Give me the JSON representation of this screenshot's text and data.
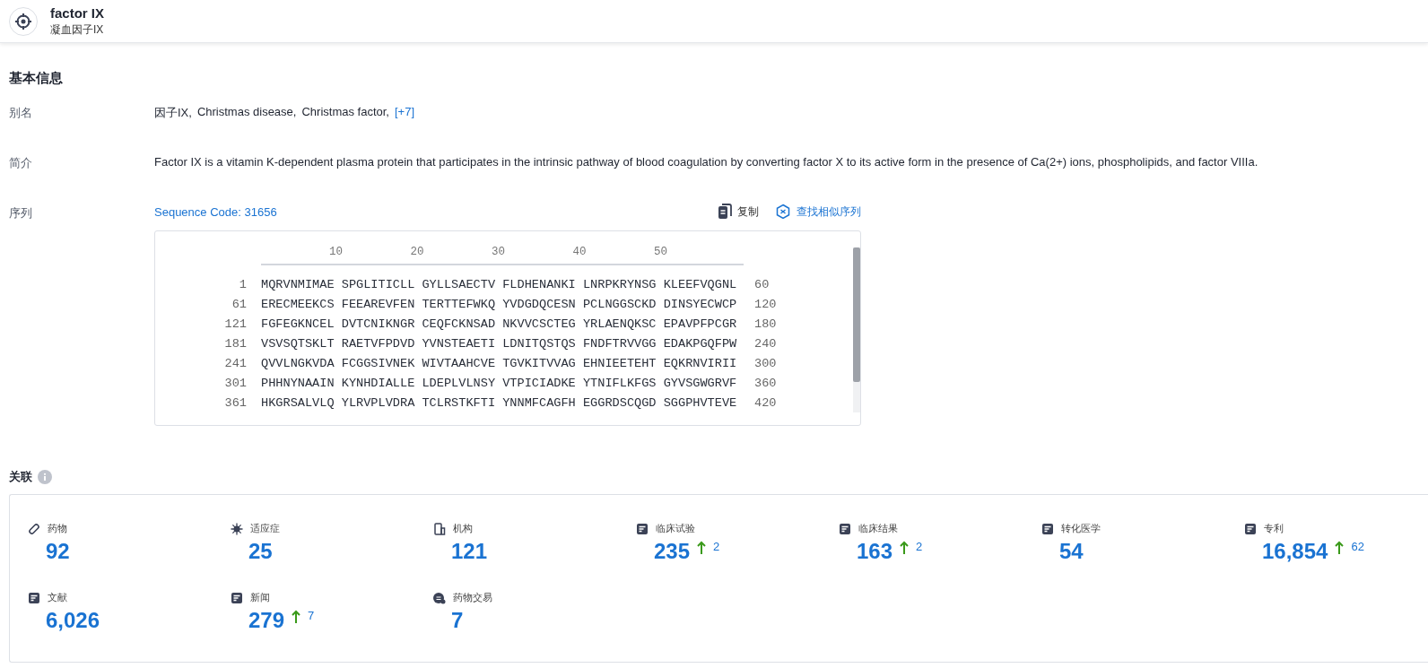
{
  "header": {
    "title": "factor IX",
    "subtitle": "凝血因子IX"
  },
  "basic_info": {
    "title": "基本信息",
    "aliases": {
      "label": "别名",
      "items": [
        "因子IX,",
        "Christmas disease,",
        "Christmas factor,"
      ],
      "more": "[+7]"
    },
    "summary": {
      "label": "简介",
      "text": "Factor IX is a vitamin K-dependent plasma protein that participates in the intrinsic pathway of blood coagulation by converting factor X to its active form in the presence of Ca(2+) ions, phospholipids, and factor VIIIa."
    },
    "sequence": {
      "label": "序列",
      "code": "Sequence Code: 31656",
      "copy": "复制",
      "find_similar": "查找相似序列",
      "ruler": [
        "10",
        "20",
        "30",
        "40",
        "50"
      ],
      "rows": [
        {
          "start": "1",
          "residues": "MQRVNMIMAE SPGLITICLL GYLLSAECTV FLDHENANKI LNRPKRYNSG KLEEFVQGNL",
          "end": "60"
        },
        {
          "start": "61",
          "residues": "ERECMEEKCS FEEAREVFEN TERTTEFWKQ YVDGDQCESN PCLNGGSCKD DINSYECWCP",
          "end": "120"
        },
        {
          "start": "121",
          "residues": "FGFEGKNCEL DVTCNIKNGR CEQFCKNSAD NKVVCSCTEG YRLAENQKSC EPAVPFPCGR",
          "end": "180"
        },
        {
          "start": "181",
          "residues": "VSVSQTSKLT RAETVFPDVD YVNSTEAETI LDNITQSTQS FNDFTRVVGG EDAKPGQFPW",
          "end": "240"
        },
        {
          "start": "241",
          "residues": "QVVLNGKVDA FCGGSIVNEK WIVTAAHCVE TGVKITVVAG EHNIEETEHT EQKRNVIRII",
          "end": "300"
        },
        {
          "start": "301",
          "residues": "PHHNYNAAIN KYNHDIALLE LDEPLVLNSY VTPICIADKE YTNIFLKFGS GYVSGWGRVF",
          "end": "360"
        },
        {
          "start": "361",
          "residues": "HKGRSALVLQ YLRVPLVDRA TCLRSTKFTI YNNMFCAGFH EGGRDSCQGD SGGPHVTEVE",
          "end": "420"
        }
      ]
    }
  },
  "related": {
    "title": "关联",
    "stats": [
      {
        "label": "药物",
        "value": "92"
      },
      {
        "label": "适应症",
        "value": "25"
      },
      {
        "label": "机构",
        "value": "121"
      },
      {
        "label": "临床试验",
        "value": "235",
        "delta": "2"
      },
      {
        "label": "临床结果",
        "value": "163",
        "delta": "2"
      },
      {
        "label": "转化医学",
        "value": "54"
      },
      {
        "label": "专利",
        "value": "16,854",
        "delta": "62"
      },
      {
        "label": "文献",
        "value": "6,026"
      },
      {
        "label": "新闻",
        "value": "279",
        "delta": "7"
      },
      {
        "label": "药物交易",
        "value": "7"
      }
    ]
  }
}
